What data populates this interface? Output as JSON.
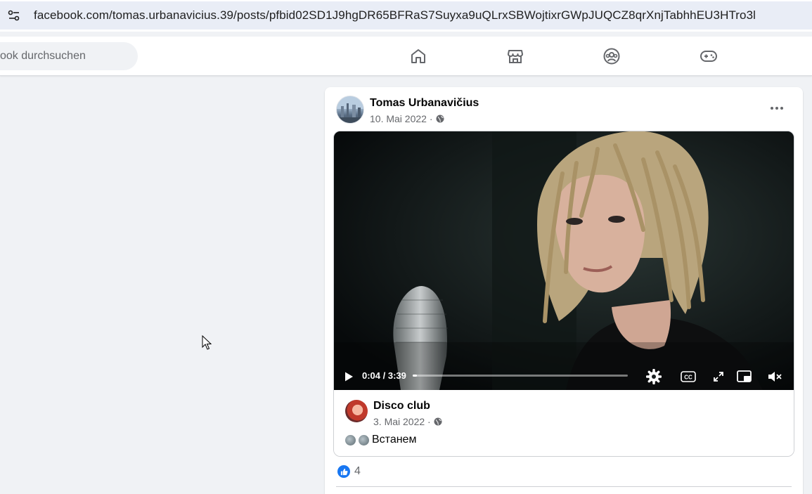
{
  "browser": {
    "url": "facebook.com/tomas.urbanavicius.39/posts/pfbid02SD1J9hgDR65BFRaS7Suyxa9uQLrxSBWojtixrGWpJUQCZ8qrXnjTabhhEU3HTro3l"
  },
  "header": {
    "search_placeholder": "ook durchsuchen",
    "nav_icons": [
      "home-icon",
      "marketplace-icon",
      "groups-icon",
      "gaming-icon"
    ]
  },
  "post": {
    "author": "Tomas Urbanavičius",
    "date": "10. Mai 2022 ·",
    "more_icon": "more-options-icon",
    "video": {
      "time": "0:04 / 3:39",
      "progress_fraction": 0.018
    },
    "shared": {
      "author": "Disco club",
      "date": "3. Mai 2022 ·",
      "text": "Встанем"
    },
    "reactions": {
      "count": "4"
    }
  },
  "colors": {
    "accent": "#1877f2",
    "page_bg": "#f0f2f5",
    "urlbar_bg": "#e9edf6"
  }
}
